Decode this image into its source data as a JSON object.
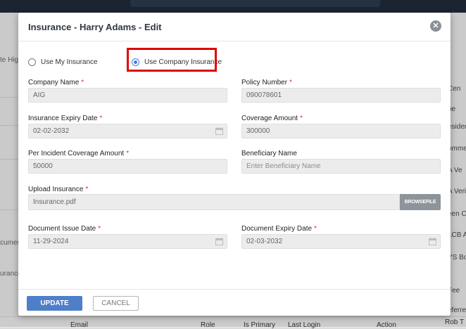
{
  "background": {
    "left_texts": [
      "te Hig",
      "cument",
      "urance"
    ],
    "right_items": [
      "Cen",
      "pe",
      "esiden",
      "ommer",
      "A Ve",
      "A Veri",
      "een C",
      "LCB A",
      "YS Bo",
      "Fee",
      "eferre"
    ],
    "table_headers": [
      "Email",
      "Role",
      "Is Primary",
      "Last Login",
      "Action"
    ],
    "footer_right": "Rob T"
  },
  "modal": {
    "title": "Insurance - Harry Adams - Edit",
    "close_glyph": "✕",
    "options": {
      "my_insurance": "Use My Insurance",
      "company_insurance": "Use Company Insurance"
    },
    "fields": {
      "company_name": {
        "label": "Company Name",
        "value": "AIG"
      },
      "policy_number": {
        "label": "Policy Number",
        "value": "090078601"
      },
      "insurance_expiry": {
        "label": "Insurance Expiry Date",
        "value": "02-02-2032"
      },
      "coverage_amount": {
        "label": "Coverage Amount",
        "value": "300000"
      },
      "per_incident": {
        "label": "Per Incident Coverage Amount",
        "value": "50000"
      },
      "beneficiary": {
        "label": "Beneficiary Name",
        "placeholder": "Enter Beneficiary Name"
      },
      "upload": {
        "label": "Upload Insurance",
        "value": "Insurance.pdf",
        "button": "BROWSEFILE"
      },
      "doc_issue": {
        "label": "Document Issue Date",
        "value": "11-29-2024"
      },
      "doc_expiry": {
        "label": "Document Expiry Date",
        "value": "02-03-2032"
      }
    },
    "required_mark": "*",
    "buttons": {
      "update": "UPDATE",
      "cancel": "CANCEL"
    }
  },
  "colors": {
    "accent": "#4f7fc9",
    "highlight": "#e00000",
    "required": "#d33333"
  },
  "selected_option": "company_insurance"
}
